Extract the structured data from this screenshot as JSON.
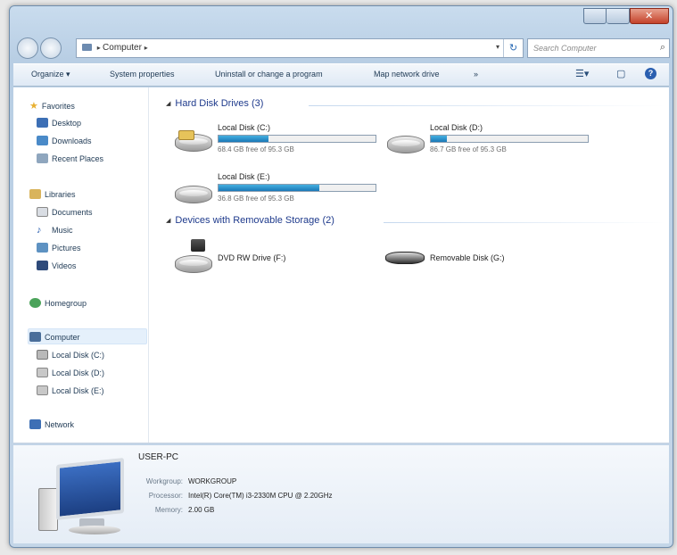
{
  "window": {
    "address_path": "Computer",
    "search_placeholder": "Search Computer"
  },
  "toolbar": {
    "organize": "Organize ▾",
    "system_properties": "System properties",
    "uninstall": "Uninstall or change a program",
    "map_drive": "Map network drive",
    "more": "»"
  },
  "sidebar": {
    "favorites": "Favorites",
    "desktop": "Desktop",
    "downloads": "Downloads",
    "recent": "Recent Places",
    "libraries": "Libraries",
    "documents": "Documents",
    "music": "Music",
    "pictures": "Pictures",
    "videos": "Videos",
    "homegroup": "Homegroup",
    "computer": "Computer",
    "disk_c": "Local Disk (C:)",
    "disk_d": "Local Disk (D:)",
    "disk_e": "Local Disk (E:)",
    "network": "Network"
  },
  "groups": {
    "hdd": "Hard Disk Drives (3)",
    "removable": "Devices with Removable Storage (2)"
  },
  "drives": [
    {
      "name": "Local Disk (C:)",
      "free": "68.4 GB free of 95.3 GB",
      "used_fraction": 0.32
    },
    {
      "name": "Local Disk (D:)",
      "free": "86.7 GB free of 95.3 GB",
      "used_fraction": 0.1
    },
    {
      "name": "Local Disk (E:)",
      "free": "36.8 GB free of 95.3 GB",
      "used_fraction": 0.64
    }
  ],
  "devices": [
    {
      "name": "DVD RW Drive (F:)"
    },
    {
      "name": "Removable Disk (G:)"
    }
  ],
  "details": {
    "pc_name": "USER-PC",
    "workgroup_label": "Workgroup:",
    "workgroup": "WORKGROUP",
    "processor_label": "Processor:",
    "processor": "Intel(R) Core(TM) i3-2330M CPU @ 2.20GHz",
    "memory_label": "Memory:",
    "memory": "2.00 GB"
  },
  "colors": {
    "accent": "#1e3a8c",
    "bar_fill": "#1a78b8"
  }
}
